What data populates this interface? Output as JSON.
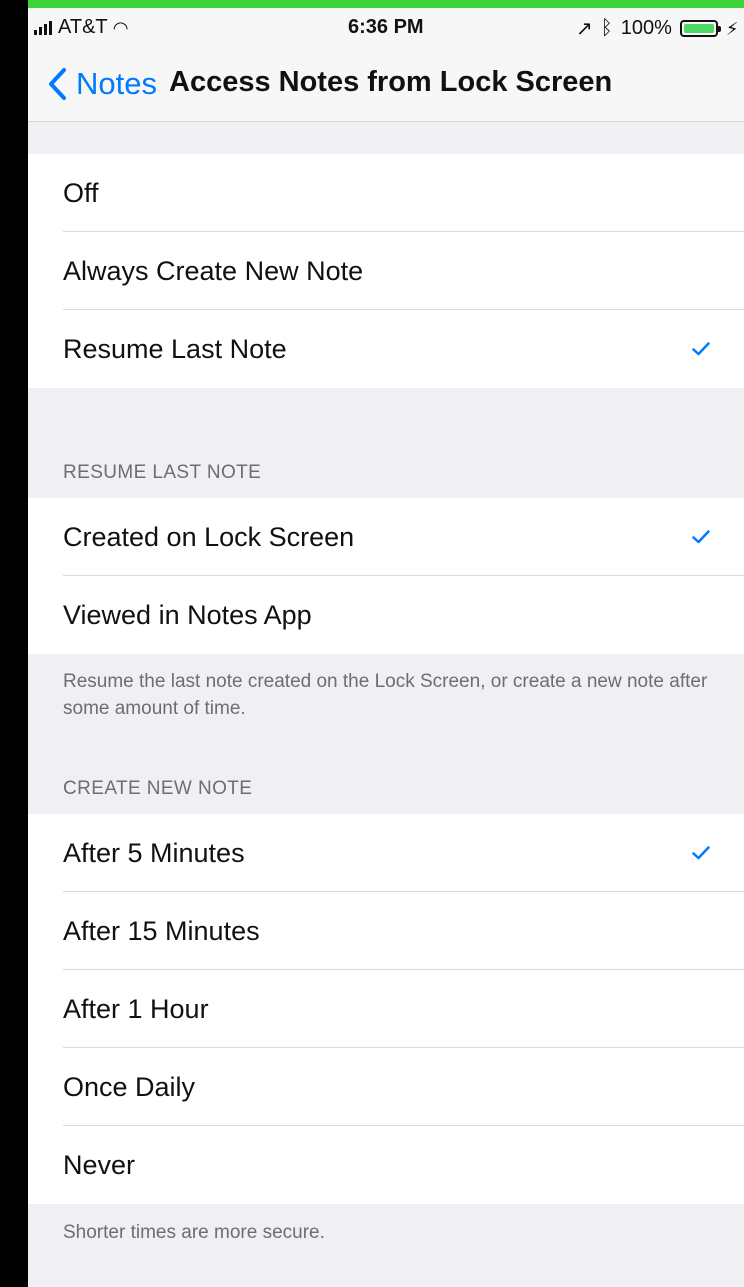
{
  "status_bar": {
    "carrier": "AT&T",
    "time": "6:36 PM",
    "battery": "100%",
    "icons": [
      "signal-icon",
      "wifi-icon",
      "location-icon",
      "bluetooth-icon",
      "battery-icon",
      "charging-icon"
    ]
  },
  "nav": {
    "back_label": "Notes",
    "title": "Access Notes from Lock Screen"
  },
  "group_main": {
    "items": [
      {
        "label": "Off",
        "selected": false
      },
      {
        "label": "Always Create New Note",
        "selected": false
      },
      {
        "label": "Resume Last Note",
        "selected": true
      }
    ]
  },
  "group_resume": {
    "header": "RESUME LAST NOTE",
    "items": [
      {
        "label": "Created on Lock Screen",
        "selected": true
      },
      {
        "label": "Viewed in Notes App",
        "selected": false
      }
    ],
    "footer": "Resume the last note created on the Lock Screen, or create a new note after some amount of time."
  },
  "group_create": {
    "header": "CREATE NEW NOTE",
    "items": [
      {
        "label": "After 5 Minutes",
        "selected": true
      },
      {
        "label": "After 15 Minutes",
        "selected": false
      },
      {
        "label": "After 1 Hour",
        "selected": false
      },
      {
        "label": "Once Daily",
        "selected": false
      },
      {
        "label": "Never",
        "selected": false
      }
    ],
    "footer": "Shorter times are more secure."
  },
  "colors": {
    "accent": "#007aff",
    "background": "#efeff4",
    "cell": "#ffffff",
    "top_strip": "#3fd33a"
  }
}
